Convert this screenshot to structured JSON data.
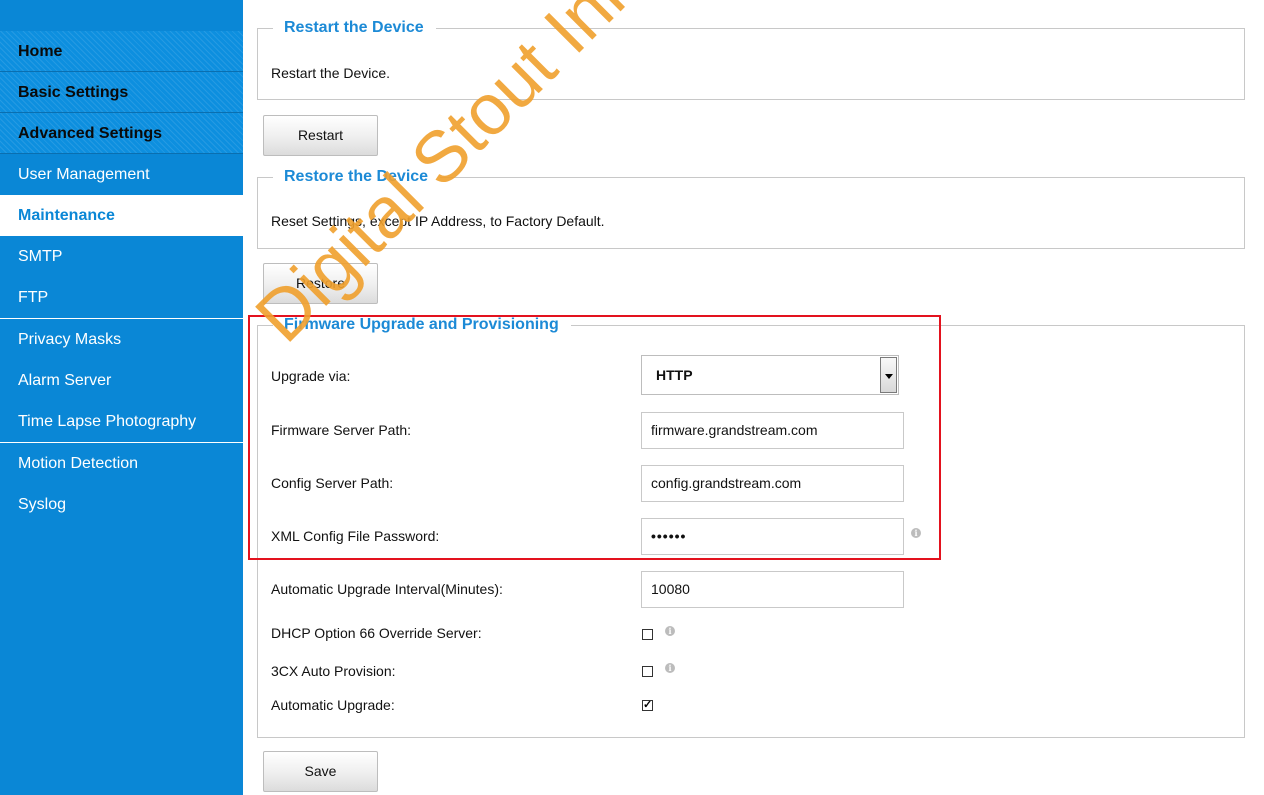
{
  "sidebar": {
    "items": [
      {
        "label": "Home"
      },
      {
        "label": "Basic Settings"
      },
      {
        "label": "Advanced Settings"
      },
      {
        "label": "User Management"
      },
      {
        "label": "Maintenance"
      },
      {
        "label": "SMTP"
      },
      {
        "label": "FTP"
      },
      {
        "label": "Privacy Masks"
      },
      {
        "label": "Alarm Server"
      },
      {
        "label": "Time Lapse Photography"
      },
      {
        "label": "Motion Detection"
      },
      {
        "label": "Syslog"
      }
    ]
  },
  "restart": {
    "legend": "Restart the Device",
    "text": "Restart the Device.",
    "button": "Restart"
  },
  "restore": {
    "legend": "Restore the Device",
    "text": "Reset Settings, except IP Address, to Factory Default.",
    "button": "Restore"
  },
  "firmware": {
    "legend": "Firmware Upgrade and Provisioning",
    "upgrade_via_label": "Upgrade via:",
    "upgrade_via_value": "HTTP",
    "server_path_label": "Firmware Server Path:",
    "server_path_value": "firmware.grandstream.com",
    "config_path_label": "Config Server Path:",
    "config_path_value": "config.grandstream.com",
    "xml_password_label": "XML Config File Password:",
    "xml_password_value": "••••••",
    "interval_label": "Automatic Upgrade Interval(Minutes):",
    "interval_value": "10080",
    "dhcp66_label": "DHCP Option 66 Override Server:",
    "dhcp66_checked": false,
    "cx3_label": "3CX Auto Provision:",
    "cx3_checked": false,
    "auto_upgrade_label": "Automatic Upgrade:",
    "auto_upgrade_checked": true
  },
  "save_button": "Save",
  "info_glyph": "i",
  "watermark": "Digital Stout Innovation &",
  "colors": {
    "sidebar_blue": "#0a87d6",
    "legend_blue": "#1c8ad6",
    "highlight_red": "#e3121e",
    "watermark_orange": "#f0a02d"
  }
}
